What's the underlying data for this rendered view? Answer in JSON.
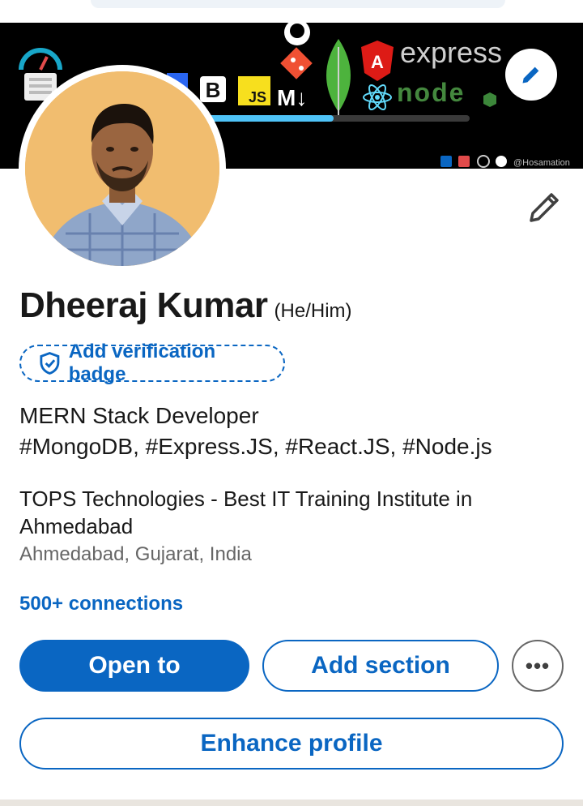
{
  "profile": {
    "name": "Dheeraj Kumar",
    "pronouns": "(He/Him)",
    "verification_label": "Add verification badge",
    "headline_line1": "MERN Stack Developer",
    "headline_line2": "#MongoDB, #Express.JS, #React.JS, #Node.js",
    "company": "TOPS Technologies - Best IT Training Institute in Ahmedabad",
    "location": "Ahmedabad, Gujarat, India",
    "connections": "500+ connections"
  },
  "banner": {
    "express_text": "express",
    "node_text": "node",
    "handle_text": "@Hosamation"
  },
  "actions": {
    "open_to": "Open to",
    "add_section": "Add section",
    "more": "•••",
    "enhance_profile": "Enhance profile"
  },
  "icons": {
    "edit_banner": "pencil-icon",
    "edit_profile": "pencil-icon",
    "verify": "shield-check-icon",
    "more": "ellipsis-icon"
  },
  "colors": {
    "accent": "#0a66c2",
    "banner_bg": "#000000",
    "text_primary": "#191919",
    "text_secondary": "#666666"
  }
}
